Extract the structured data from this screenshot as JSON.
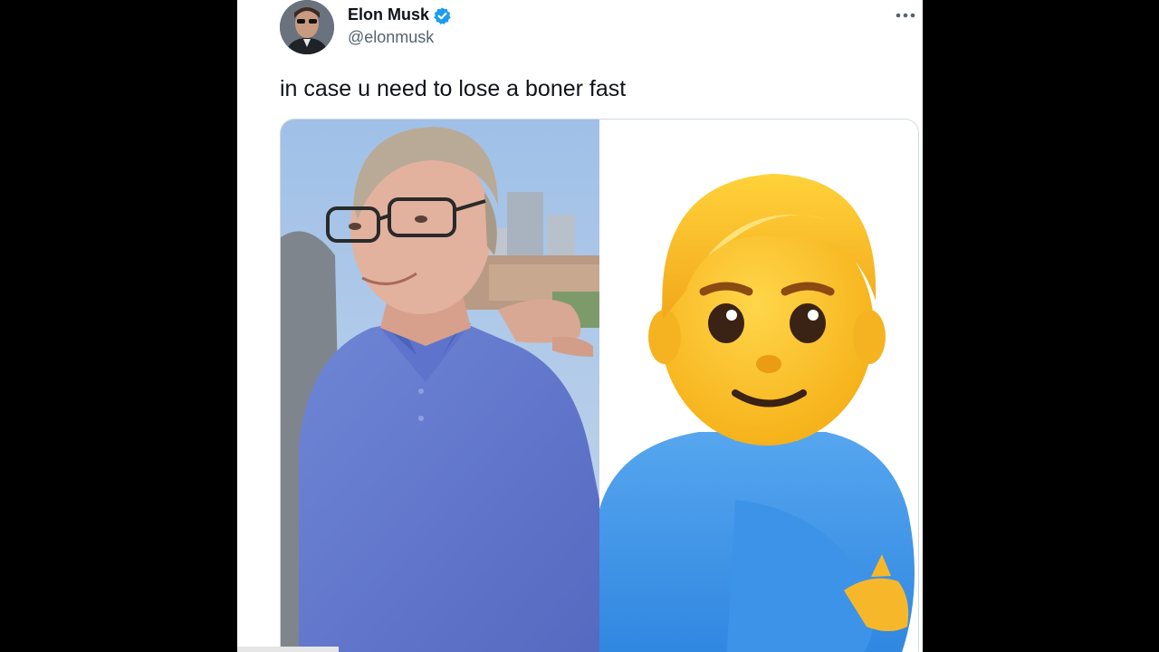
{
  "author": {
    "display_name": "Elon Musk",
    "handle": "@elonmusk",
    "verified": true
  },
  "tweet": {
    "text": "in case u need to lose a boner fast"
  },
  "media": {
    "left_image": "photo-man-blue-polo",
    "right_image": "pregnant-man-emoji"
  },
  "icons": {
    "verified": "verified-badge-icon",
    "more": "more-options-icon"
  },
  "colors": {
    "verified_blue": "#1d9bf0",
    "text_primary": "#0f1419",
    "text_secondary": "#536471"
  }
}
